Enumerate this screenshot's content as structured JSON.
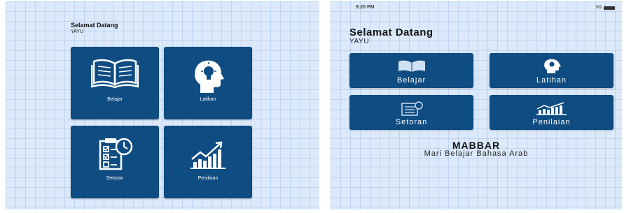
{
  "left_screen": {
    "greeting": {
      "title": "Selamat Datang",
      "user": "YAYU"
    },
    "menu": [
      {
        "label": "Belajar",
        "icon": "open-book-icon"
      },
      {
        "label": "Latihan",
        "icon": "head-lightbulb-icon"
      },
      {
        "label": "Setoran",
        "icon": "clipboard-checklist-clock-icon"
      },
      {
        "label": "Penilaian",
        "icon": "bar-chart-trend-icon"
      }
    ]
  },
  "right_screen": {
    "status_bar": {
      "time": "9:20 PM",
      "signal": "5G"
    },
    "greeting": {
      "title": "Selamat Datang",
      "user": "YAYU"
    },
    "menu": [
      {
        "label": "Belajar",
        "icon": "open-book-icon"
      },
      {
        "label": "Latihan",
        "icon": "head-lightbulb-icon"
      },
      {
        "label": "Setoran",
        "icon": "clipboard-checklist-clock-icon"
      },
      {
        "label": "Penilaian",
        "icon": "bar-chart-trend-icon"
      }
    ],
    "footer": {
      "app_name": "MABBAR",
      "tagline": "Mari Belajar Bahasa Arab"
    }
  },
  "colors": {
    "tile": "#0f4c81",
    "background": "#dce9fa",
    "grid": "#a6c1e6"
  }
}
